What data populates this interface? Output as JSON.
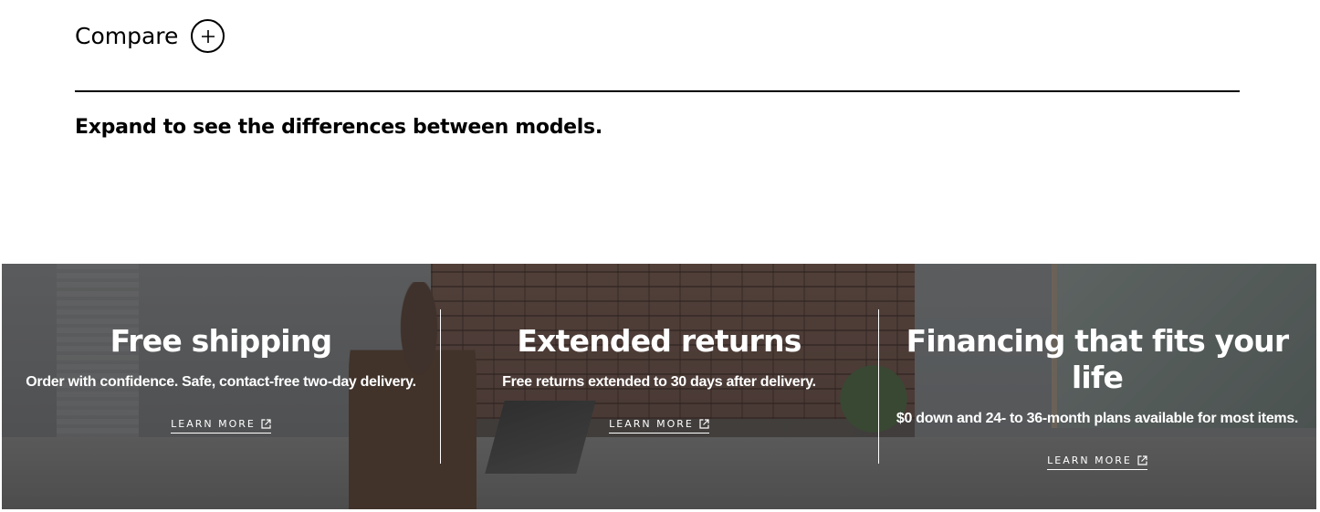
{
  "compare": {
    "title": "Compare",
    "toggle_icon": "plus-icon",
    "description": "Expand to see the differences between models."
  },
  "banner": {
    "panels": [
      {
        "title": "Free shipping",
        "text": "Order with confidence. Safe, contact-free two-day delivery.",
        "link": "LEARN MORE",
        "link_icon": "external-link-icon"
      },
      {
        "title": "Extended returns",
        "text": "Free returns extended to 30 days after delivery.",
        "link": "LEARN MORE",
        "link_icon": "external-link-icon"
      },
      {
        "title": "Financing that fits your life",
        "text": "$0 down and 24- to 36-month plans available for most items.",
        "link": "LEARN MORE",
        "link_icon": "external-link-icon"
      }
    ]
  }
}
